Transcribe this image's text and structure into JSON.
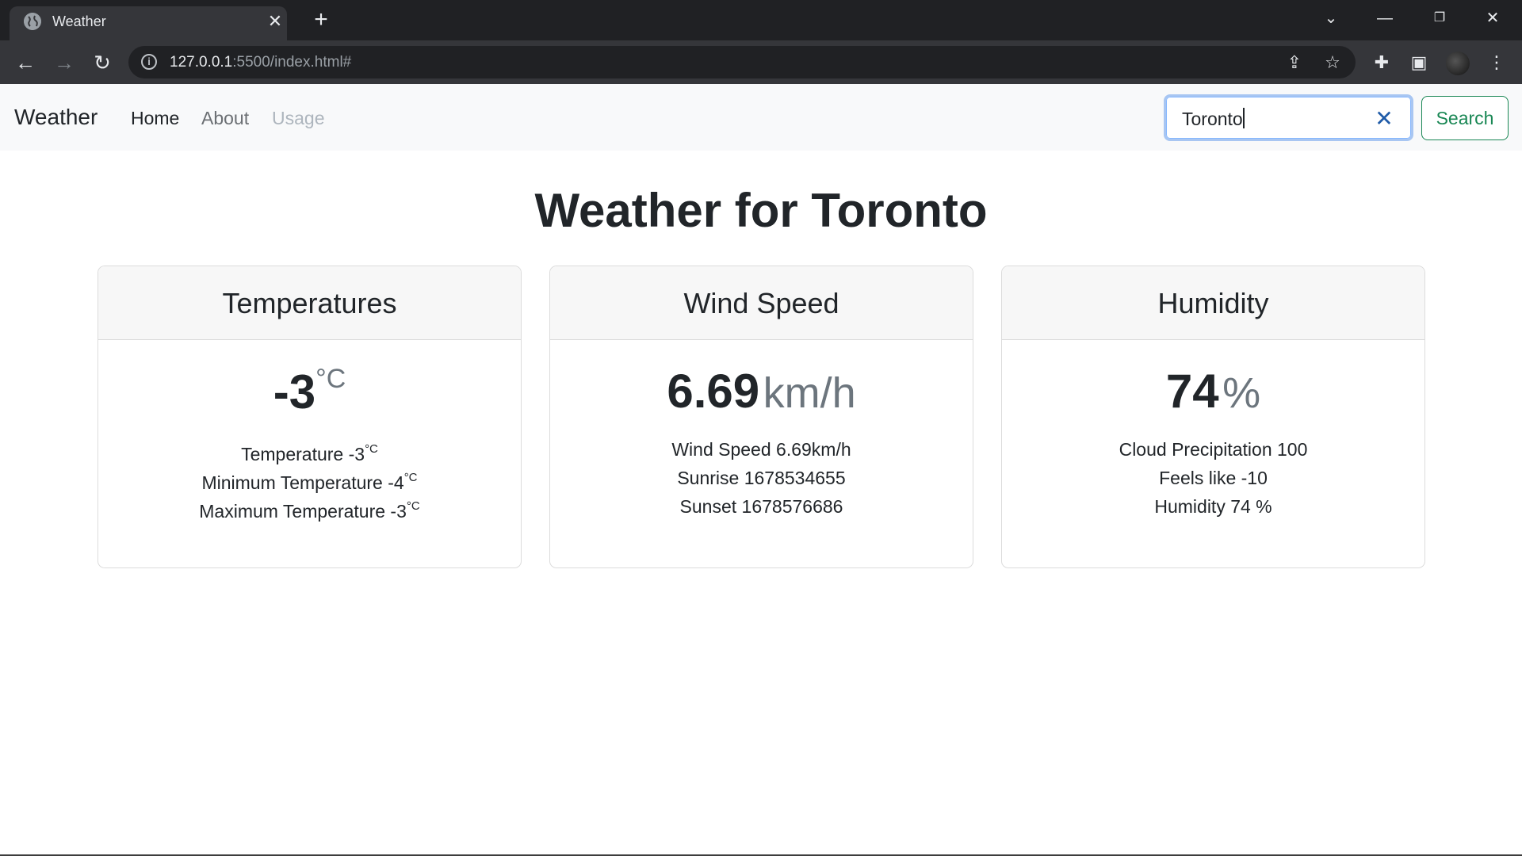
{
  "browser": {
    "tab_title": "Weather",
    "url_host": "127.0.0.1",
    "url_rest": ":5500/index.html#"
  },
  "navbar": {
    "brand": "Weather",
    "links": [
      "Home",
      "About",
      "Usage"
    ],
    "search_value": "Toronto",
    "search_button": "Search"
  },
  "main": {
    "title": "Weather for Toronto",
    "cards": [
      {
        "header": "Temperatures",
        "value": "-3",
        "unit": "°C",
        "lines": [
          {
            "text": "Temperature -3",
            "unit": "°C"
          },
          {
            "text": "Minimum Temperature -4",
            "unit": "°C"
          },
          {
            "text": "Maximum Temperature -3",
            "unit": "°C"
          }
        ]
      },
      {
        "header": "Wind Speed",
        "value": "6.69",
        "unit": "km/h",
        "lines": [
          {
            "text": "Wind Speed 6.69km/h"
          },
          {
            "text": "Sunrise 1678534655"
          },
          {
            "text": "Sunset 1678576686"
          }
        ]
      },
      {
        "header": "Humidity",
        "value": "74",
        "unit": "%",
        "lines": [
          {
            "text": "Cloud Precipitation 100"
          },
          {
            "text": "Feels like -10"
          },
          {
            "text": "Humidity 74 %"
          }
        ]
      }
    ]
  },
  "icons": [
    "globe-icon",
    "close-icon",
    "plus-icon",
    "chevron-down-icon",
    "minimize-icon",
    "restore-icon",
    "back-icon",
    "forward-icon",
    "reload-icon",
    "info-icon",
    "share-icon",
    "star-icon",
    "extensions-icon",
    "side-panel-icon",
    "menu-icon"
  ],
  "colors": {
    "accent_green": "#198754",
    "focus_blue": "#86b7fe"
  }
}
